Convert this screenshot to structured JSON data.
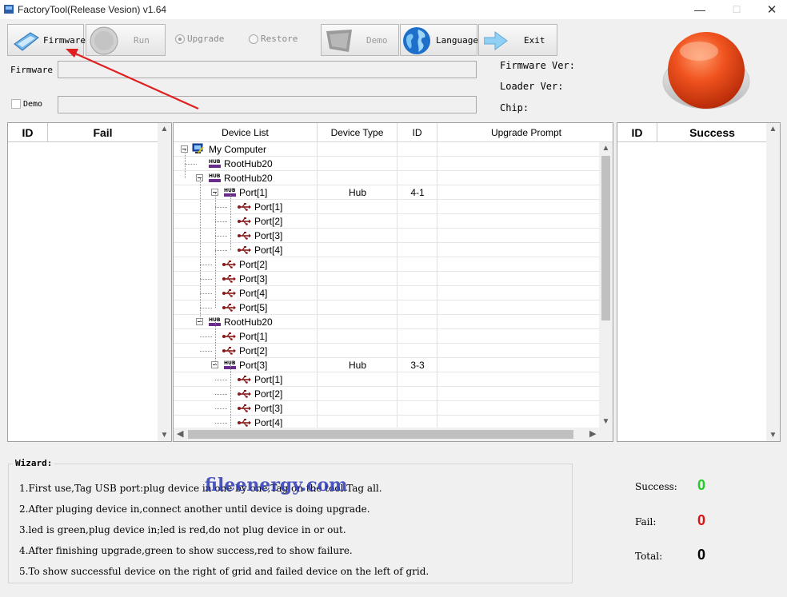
{
  "window": {
    "title": "FactoryTool(Release Vesion) v1.64",
    "minimize": "—",
    "maximize": "☐",
    "close": "✕"
  },
  "toolbar": {
    "firmware": "Firmware",
    "run": "Run",
    "upgrade": "Upgrade",
    "restore": "Restore",
    "demo": "Demo",
    "language": "Language",
    "exit": "Exit"
  },
  "fields": {
    "firmware_label": "Firmware",
    "demo_label": "Demo",
    "firmware_value": "",
    "demo_value": ""
  },
  "info": {
    "firmware_ver": "Firmware Ver:",
    "loader_ver": "Loader Ver:",
    "chip": "Chip:"
  },
  "fail_grid": {
    "col_id": "ID",
    "col_name": "Fail"
  },
  "success_grid": {
    "col_id": "ID",
    "col_name": "Success"
  },
  "device_list": {
    "columns": [
      "Device List",
      "Device Type",
      "ID",
      "Upgrade Prompt"
    ],
    "rows": [
      {
        "label": "My Computer",
        "icon": "computer-icon",
        "type": "",
        "id": ""
      },
      {
        "label": "RootHub20",
        "icon": "hub-icon",
        "type": "",
        "id": ""
      },
      {
        "label": "RootHub20",
        "icon": "hub-icon",
        "type": "",
        "id": ""
      },
      {
        "label": "Port[1]",
        "icon": "hub-icon",
        "type": "Hub",
        "id": "4-1"
      },
      {
        "label": "Port[1]",
        "icon": "usb-icon",
        "type": "",
        "id": ""
      },
      {
        "label": "Port[2]",
        "icon": "usb-icon",
        "type": "",
        "id": ""
      },
      {
        "label": "Port[3]",
        "icon": "usb-icon",
        "type": "",
        "id": ""
      },
      {
        "label": "Port[4]",
        "icon": "usb-icon",
        "type": "",
        "id": ""
      },
      {
        "label": "Port[2]",
        "icon": "usb-icon",
        "type": "",
        "id": ""
      },
      {
        "label": "Port[3]",
        "icon": "usb-icon",
        "type": "",
        "id": ""
      },
      {
        "label": "Port[4]",
        "icon": "usb-icon",
        "type": "",
        "id": ""
      },
      {
        "label": "Port[5]",
        "icon": "usb-icon",
        "type": "",
        "id": ""
      },
      {
        "label": "RootHub20",
        "icon": "hub-icon",
        "type": "",
        "id": ""
      },
      {
        "label": "Port[1]",
        "icon": "usb-icon",
        "type": "",
        "id": ""
      },
      {
        "label": "Port[2]",
        "icon": "usb-icon",
        "type": "",
        "id": ""
      },
      {
        "label": "Port[3]",
        "icon": "hub-icon",
        "type": "Hub",
        "id": "3-3"
      },
      {
        "label": "Port[1]",
        "icon": "usb-icon",
        "type": "",
        "id": ""
      },
      {
        "label": "Port[2]",
        "icon": "usb-icon",
        "type": "",
        "id": ""
      },
      {
        "label": "Port[3]",
        "icon": "usb-icon",
        "type": "",
        "id": ""
      },
      {
        "label": "Port[4]",
        "icon": "usb-icon",
        "type": "",
        "id": ""
      }
    ]
  },
  "wizard": {
    "title": "Wizard:",
    "lines": [
      "1.First use,Tag USB port:plug device in one by one,Tag on the tool.Tag all.",
      "2.After pluging device in,connect another until device is doing upgrade.",
      "3.led is green,plug device in;led is red,do not plug device in or out.",
      "4.After finishing upgrade,green to show success,red to show failure.",
      "5.To show successful device on the right of grid and failed device on the left of grid."
    ]
  },
  "stats": {
    "success_label": "Success:",
    "success_value": "0",
    "fail_label": "Fail:",
    "fail_value": "0",
    "total_label": "Total:",
    "total_value": "0"
  },
  "colors": {
    "success": "#22cc22",
    "fail": "#dd1111",
    "total": "#000000",
    "led": "#e8431b"
  },
  "watermark": "fileenergy.com"
}
